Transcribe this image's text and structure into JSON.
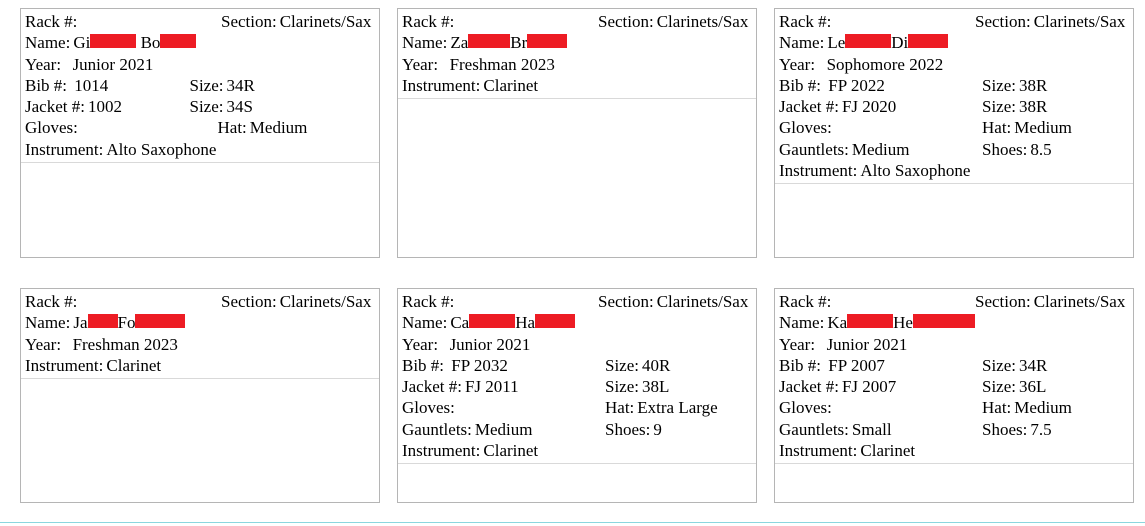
{
  "labels": {
    "rack": "Rack #:",
    "section": "Section:",
    "name": "Name:",
    "year": "Year:",
    "bib": "Bib #:",
    "jacket": "Jacket #:",
    "size": "Size:",
    "gloves": "Gloves:",
    "hat": "Hat:",
    "gauntlets": "Gauntlets:",
    "shoes": "Shoes:",
    "instrument": "Instrument:"
  },
  "cards": [
    {
      "section": "Clarinets/Sax",
      "name_pre": "Gi",
      "name_mid": "Bo",
      "year": "Junior 2021",
      "bib": "1014",
      "bib_size": "34R",
      "jacket": "1002",
      "jacket_size": "34S",
      "gloves": "",
      "hat": "Medium",
      "instrument": "Alto Saxophone"
    },
    {
      "section": "Clarinets/Sax",
      "name_pre": "Za",
      "name_mid": "Br",
      "year": "Freshman 2023",
      "instrument": "Clarinet"
    },
    {
      "section": "Clarinets/Sax",
      "name_pre": "Le",
      "name_mid": "Di",
      "year": "Sophomore 2022",
      "bib": "FP 2022",
      "bib_size": "38R",
      "jacket": "FJ 2020",
      "jacket_size": "38R",
      "gloves": "",
      "hat": "Medium",
      "gauntlets": "Medium",
      "shoes": "8.5",
      "instrument": "Alto Saxophone"
    },
    {
      "section": "Clarinets/Sax",
      "name_pre": "Ja",
      "name_mid": "Fo",
      "year": "Freshman 2023",
      "instrument": "Clarinet"
    },
    {
      "section": "Clarinets/Sax",
      "name_pre": "Ca",
      "name_mid": "Ha",
      "year": "Junior 2021",
      "bib": "FP 2032",
      "bib_size": "40R",
      "jacket": "FJ 2011",
      "jacket_size": "38L",
      "gloves": "",
      "hat": "Extra Large",
      "gauntlets": "Medium",
      "shoes": "9",
      "instrument": "Clarinet"
    },
    {
      "section": "Clarinets/Sax",
      "name_pre": "Ka",
      "name_mid": "He",
      "year": "Junior 2021",
      "bib": "FP 2007",
      "bib_size": "34R",
      "jacket": "FJ 2007",
      "jacket_size": "36L",
      "gloves": "",
      "hat": "Medium",
      "gauntlets": "Small",
      "shoes": "7.5",
      "instrument": "Clarinet"
    }
  ]
}
